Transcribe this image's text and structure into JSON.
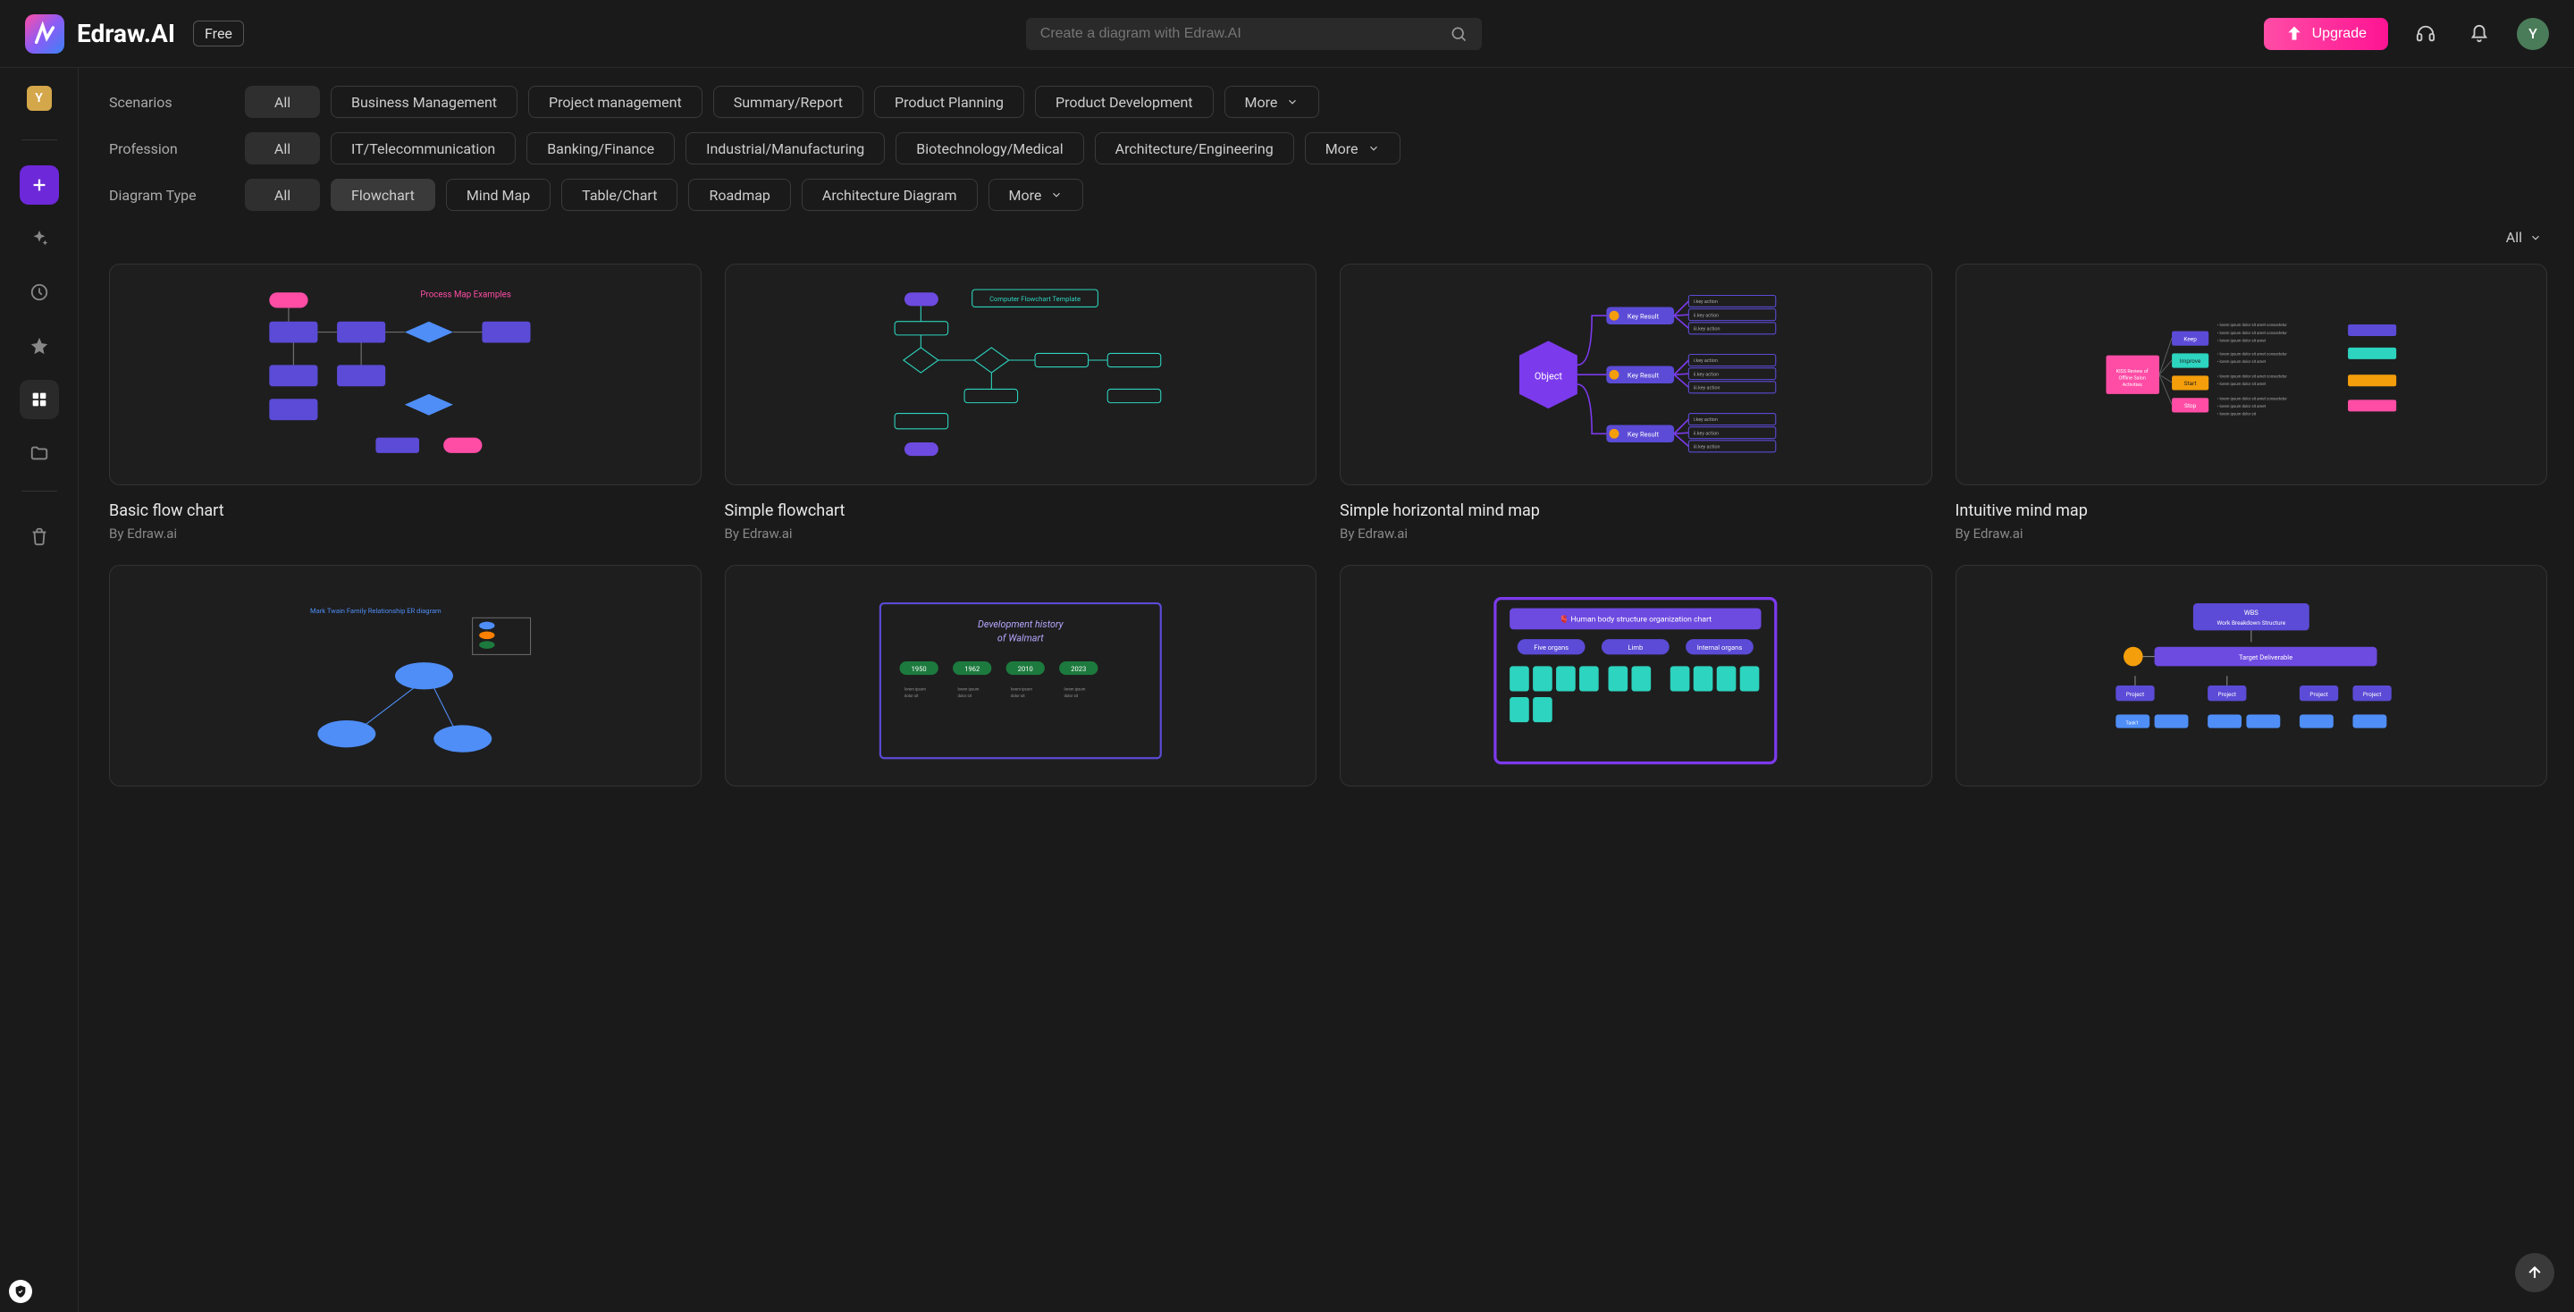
{
  "header": {
    "logo_text": "Edraw.AI",
    "badge": "Free",
    "search_placeholder": "Create a diagram with Edraw.AI",
    "upgrade_label": "Upgrade",
    "avatar_letter": "Y"
  },
  "sidebar": {
    "mini_avatar": "Y"
  },
  "filters": {
    "scenarios": {
      "label": "Scenarios",
      "all": "All",
      "items": [
        "Business Management",
        "Project management",
        "Summary/Report",
        "Product Planning",
        "Product Development"
      ],
      "more": "More"
    },
    "profession": {
      "label": "Profession",
      "all": "All",
      "items": [
        "IT/Telecommunication",
        "Banking/Finance",
        "Industrial/Manufacturing",
        "Biotechnology/Medical",
        "Architecture/Engineering"
      ],
      "more": "More"
    },
    "diagram_type": {
      "label": "Diagram Type",
      "all": "All",
      "items": [
        "Flowchart",
        "Mind Map",
        "Table/Chart",
        "Roadmap",
        "Architecture Diagram"
      ],
      "selected_index": 0,
      "more": "More"
    }
  },
  "sort": {
    "label": "All"
  },
  "cards": [
    {
      "title": "Basic flow chart",
      "author": "By Edraw.ai"
    },
    {
      "title": "Simple flowchart",
      "author": "By Edraw.ai"
    },
    {
      "title": "Simple horizontal mind map",
      "author": "By Edraw.ai"
    },
    {
      "title": "Intuitive mind map",
      "author": "By Edraw.ai"
    }
  ],
  "colors": {
    "accent_purple": "#6d28d9",
    "accent_pink": "#ff1493",
    "card_bg": "#1e1e1e",
    "teal": "#2dd4bf",
    "orange": "#f59e0b"
  }
}
